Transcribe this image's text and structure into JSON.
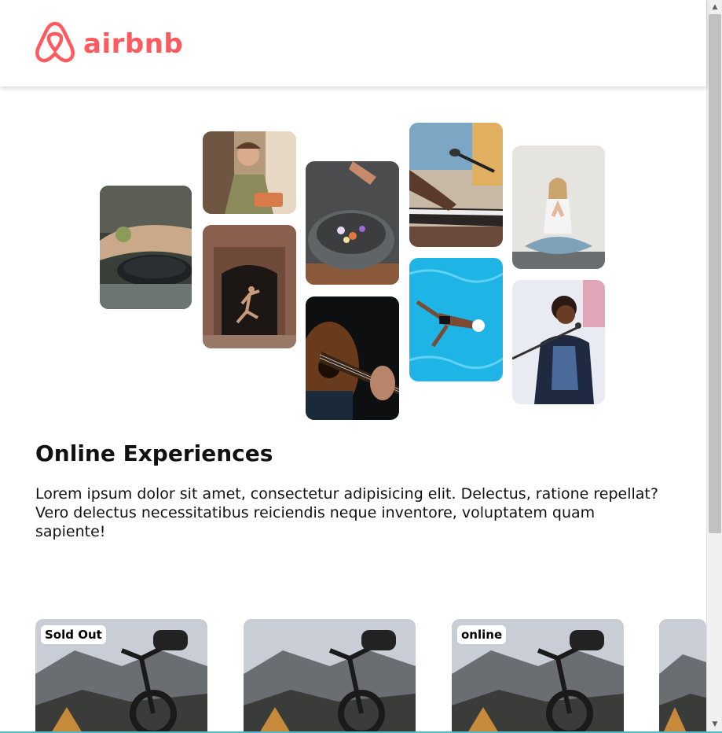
{
  "brand": {
    "name": "airbnb",
    "color": "#FF5A5F",
    "icon": "airbnb-logo-icon"
  },
  "section": {
    "title": "Online Experiences",
    "description": "Lorem ipsum dolor sit amet, consectetur adipisicing elit. Delectus, ratione repellat? Vero delectus necessitatibus reiciendis neque inventore, voluptatem quam sapiente!"
  },
  "cards": [
    {
      "badge": "Sold Out"
    },
    {
      "badge": ""
    },
    {
      "badge": "online"
    },
    {
      "badge": ""
    }
  ]
}
